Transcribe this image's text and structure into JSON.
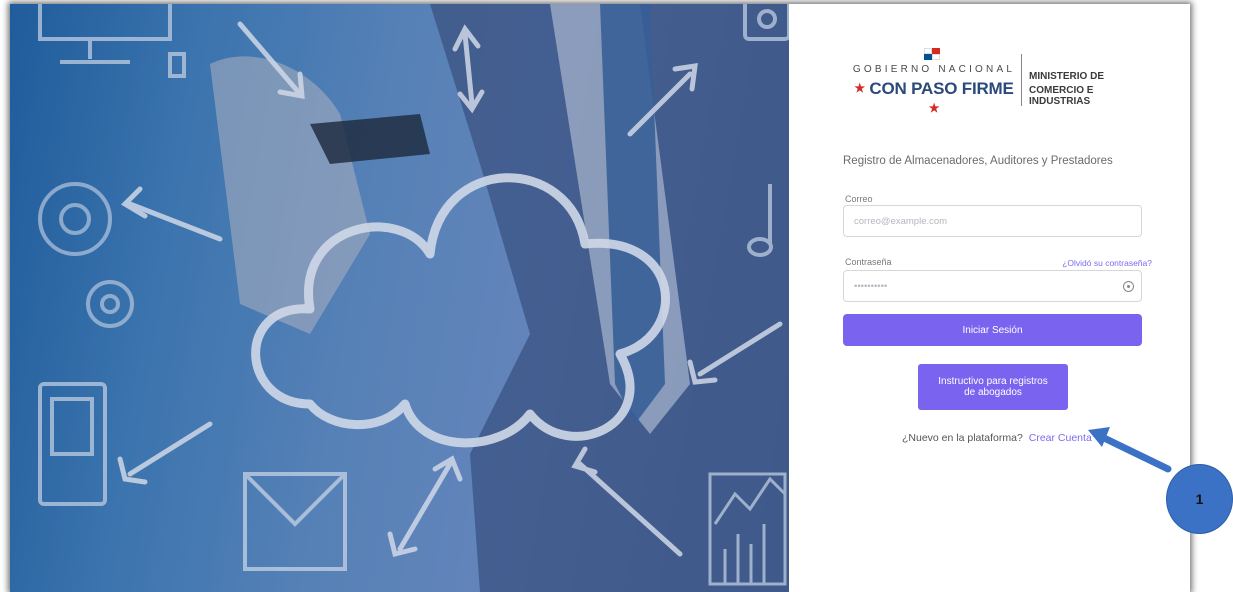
{
  "hero": {
    "image": "cloud-computing-businessman-drawing"
  },
  "logo": {
    "line1": "GOBIERNO NACIONAL",
    "line2_star_left": "★",
    "line2": "CON PASO FIRME",
    "line2_star_right": "★",
    "ministry_line1": "MINISTERIO DE",
    "ministry_line2": "COMERCIO E INDUSTRIAS"
  },
  "form": {
    "subtitle": "Registro de Almacenadores, Auditores y Prestadores",
    "email_label": "Correo",
    "email_placeholder": "correo@example.com",
    "password_label": "Contraseña",
    "password_placeholder": "••••••••••",
    "forgot_link": "¿Olvidó su contraseña?",
    "login_button": "Iniciar Sesión",
    "instructions_button": "Instructivo para registros\nde abogados",
    "new_user_text": "¿Nuevo en la plataforma?",
    "create_account_link": "Crear Cuenta"
  },
  "annotation": {
    "badge_number": "1"
  },
  "colors": {
    "accent": "#7a64ef",
    "link": "#7b6cf0",
    "badge": "#3b72c6"
  }
}
